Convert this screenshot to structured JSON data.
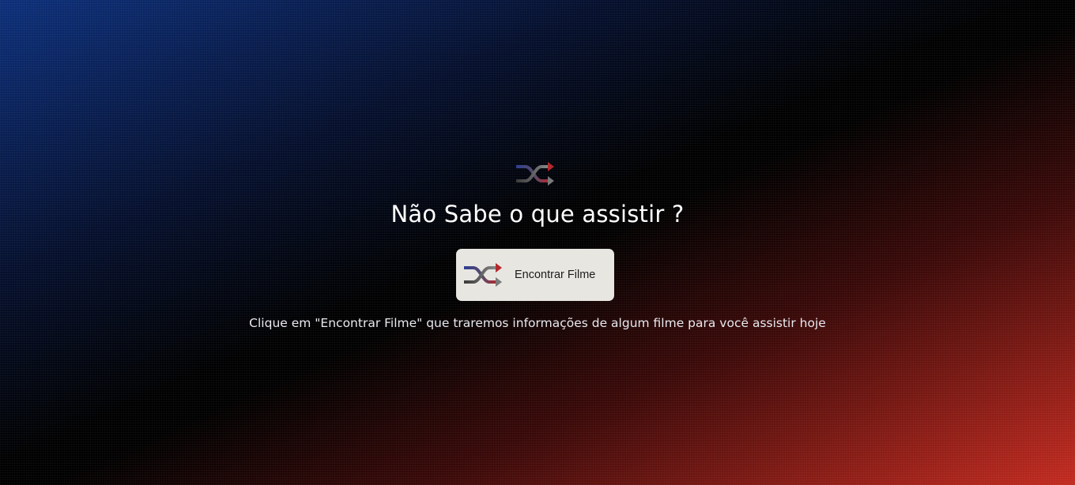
{
  "hero": {
    "icon": "shuffle-icon",
    "title": "Não Sabe o que assistir ?",
    "button": {
      "icon": "shuffle-icon",
      "label": "Encontrar Filme"
    },
    "hint": "Clique em \"Encontrar Filme\" que traremos informações de algum filme para você assistir hoje"
  },
  "colors": {
    "background_left": "#0c2f7a",
    "background_center": "#000000",
    "background_right": "#c32a1f",
    "button_background": "#e8e6e1",
    "icon_red": "#b4282b",
    "icon_blue": "#2d3f93",
    "icon_gray": "#6a6a6a"
  }
}
